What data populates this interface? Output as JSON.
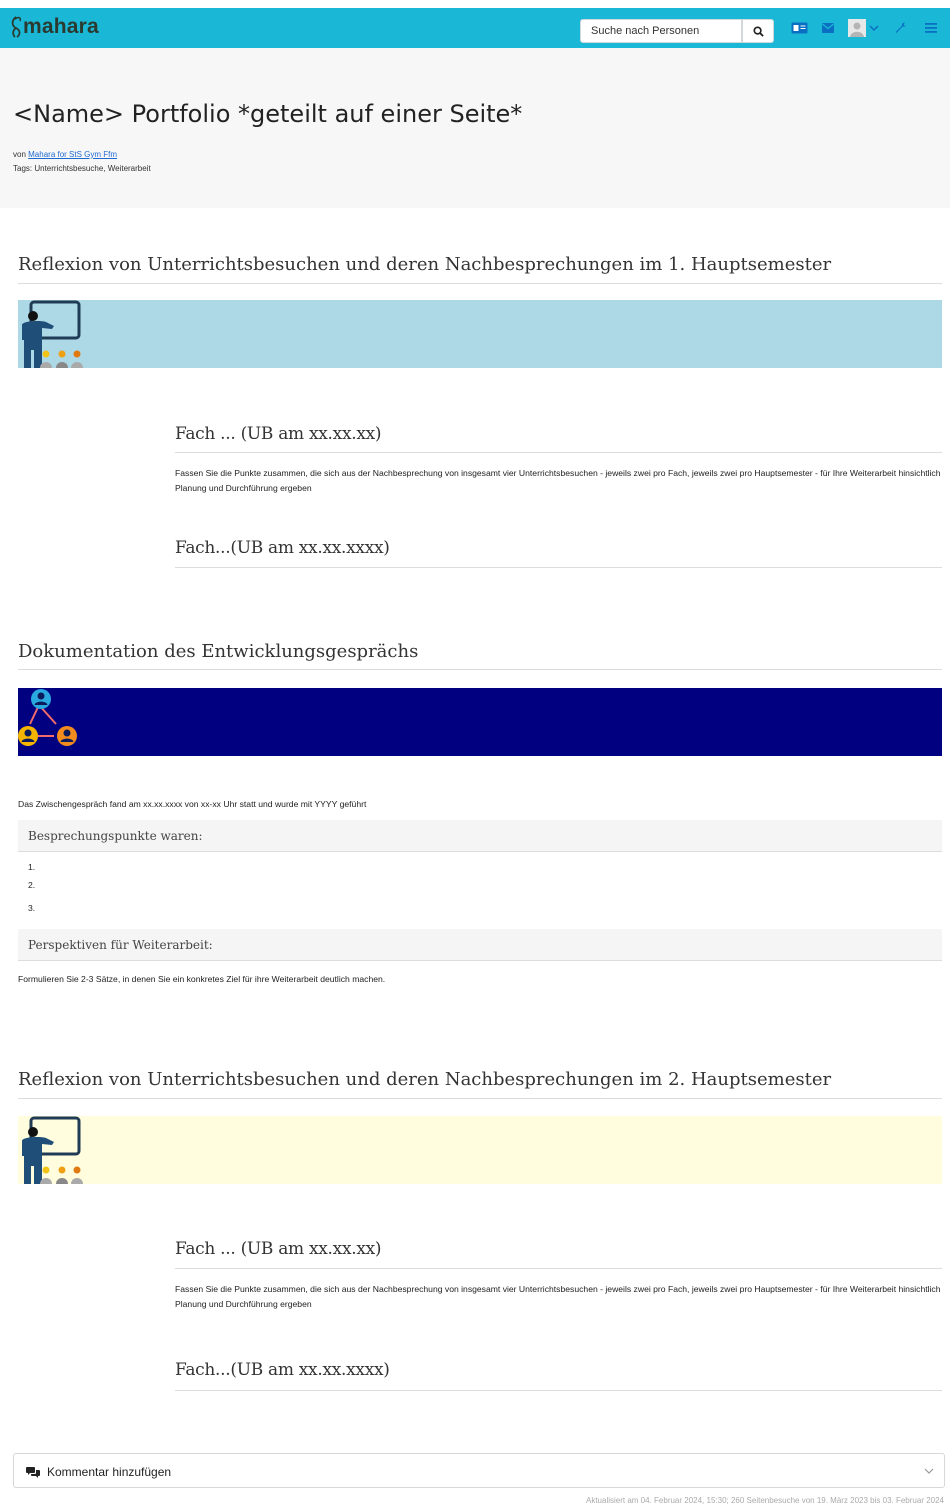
{
  "app": {
    "logo_text": "mahara",
    "brand_color": "#1ab8d6"
  },
  "navbar": {
    "search": {
      "placeholder": "Suche nach Personen"
    },
    "icons": [
      "search-icon",
      "id-card-icon",
      "mail-icon",
      "user-avatar-icon",
      "chevron-down-icon",
      "wrench-icon",
      "hamburger-menu-icon"
    ]
  },
  "page": {
    "title": "<Name> Portfolio *geteilt auf einer Seite*",
    "byline_prefix": "von",
    "author": "Mahara for StS Gym Ffm",
    "tags_text": "Tags: Unterrichtsbesuche, Weiterarbeit"
  },
  "sections": [
    {
      "title": "Reflexion von Unterrichtsbesuchen und deren Nachbesprechungen im 1. Hauptsemester",
      "banner_color": "#add8e6",
      "banner_icon": "teacher-presentation-icon",
      "items": [
        {
          "title": "Fach ... (UB am xx.xx.xx)",
          "text": "Fassen Sie die Punkte zusammen, die sich aus der Nachbesprechung von insgesamt vier Unterrichtsbesuchen - jeweils zwei pro Fach, jeweils zwei pro Hauptsemester -  für Ihre Weiterarbeit hinsichtlich Planung und Durchführung ergeben"
        },
        {
          "title": "Fach...(UB am xx.xx.xxxx)"
        }
      ]
    },
    {
      "title": "Dokumentation des Entwicklungsgesprächs",
      "banner_color": "#000080",
      "banner_icon": "people-network-icon",
      "intro": "Das Zwischengespräch fand am xx.xx.xxxx von xx-xx Uhr statt und wurde mit YYYY geführt",
      "points_title": "Besprechungspunkte waren:",
      "points": [
        "1.",
        "2.",
        "3."
      ],
      "perspectives_title": "Perspektiven für Weiterarbeit:",
      "perspectives_text": "Formulieren Sie 2-3 Sätze, in denen Sie ein konkretes Ziel für ihre Weiterarbeit deutlich machen."
    },
    {
      "title": "Reflexion von Unterrichtsbesuchen und deren Nachbesprechungen im 2. Hauptsemester",
      "banner_color": "#fffddd",
      "banner_icon": "teacher-presentation-icon",
      "items": [
        {
          "title": "Fach ... (UB am xx.xx.xx)",
          "text": "Fassen Sie die Punkte zusammen, die sich aus der Nachbesprechung von insgesamt vier Unterrichtsbesuchen - jeweils zwei pro Fach, jeweils zwei pro Hauptsemester -  für Ihre Weiterarbeit hinsichtlich Planung und Durchführung ergeben"
        },
        {
          "title": "Fach...(UB am xx.xx.xxxx)"
        }
      ]
    }
  ],
  "comments": {
    "label": "Kommentar hinzufügen"
  },
  "footer": {
    "text": "Aktualisiert am 04. Februar 2024, 15:30; 260 Seitenbesuche von 19. März 2023 bis 03. Februar 2024"
  }
}
